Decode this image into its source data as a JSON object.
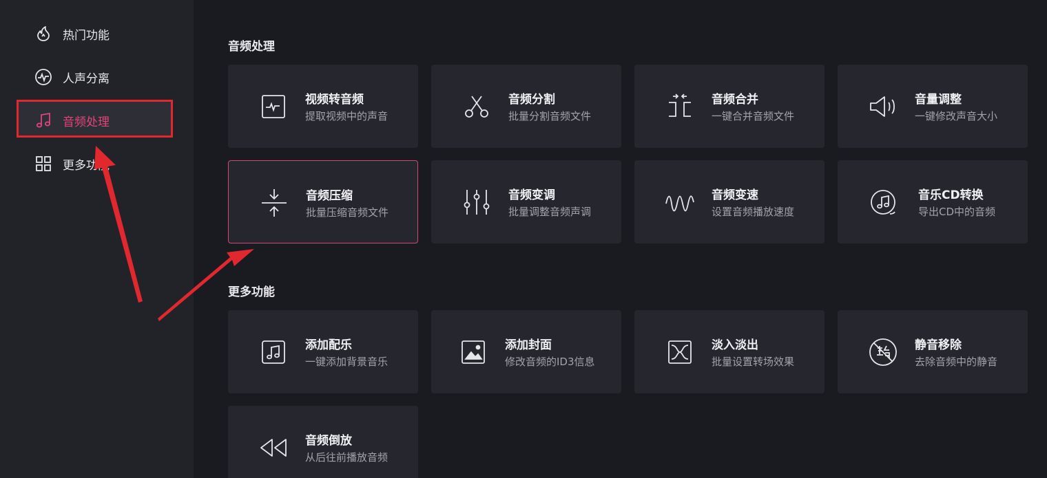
{
  "sidebar": {
    "items": [
      {
        "label": "热门功能",
        "icon": "flame-icon"
      },
      {
        "label": "人声分离",
        "icon": "pulse-circle-icon"
      },
      {
        "label": "音频处理",
        "icon": "music-note-icon"
      },
      {
        "label": "更多功能",
        "icon": "grid-icon"
      }
    ],
    "active_index": 2
  },
  "sections": {
    "audio": {
      "title": "音频处理",
      "cards": [
        {
          "title": "视频转音频",
          "desc": "提取视频中的声音",
          "icon": "video-to-audio-icon"
        },
        {
          "title": "音频分割",
          "desc": "批量分割音频文件",
          "icon": "scissors-icon"
        },
        {
          "title": "音频合并",
          "desc": "一键合并音频文件",
          "icon": "merge-icon"
        },
        {
          "title": "音量调整",
          "desc": "一键修改声音大小",
          "icon": "speaker-icon"
        },
        {
          "title": "音频压缩",
          "desc": "批量压缩音频文件",
          "icon": "compress-icon"
        },
        {
          "title": "音频变调",
          "desc": "批量调整音频声调",
          "icon": "equalizer-icon"
        },
        {
          "title": "音频变速",
          "desc": "设置音频播放速度",
          "icon": "wave-icon"
        },
        {
          "title": "音乐CD转换",
          "desc": "导出CD中的音频",
          "icon": "music-cd-icon"
        }
      ]
    },
    "more": {
      "title": "更多功能",
      "cards": [
        {
          "title": "添加配乐",
          "desc": "一键添加背景音乐",
          "icon": "add-music-icon"
        },
        {
          "title": "添加封面",
          "desc": "修改音频的ID3信息",
          "icon": "cover-image-icon"
        },
        {
          "title": "淡入淡出",
          "desc": "批量设置转场效果",
          "icon": "fade-icon"
        },
        {
          "title": "静音移除",
          "desc": "去除音频中的静音",
          "icon": "silence-remove-icon"
        },
        {
          "title": "音频倒放",
          "desc": "从后往前播放音频",
          "icon": "rewind-icon"
        }
      ]
    }
  },
  "colors": {
    "accent": "#e1457a",
    "annotation_red": "#e0282e",
    "background": "#1a1b21",
    "sidebar": "#222329",
    "card": "#26272e"
  }
}
